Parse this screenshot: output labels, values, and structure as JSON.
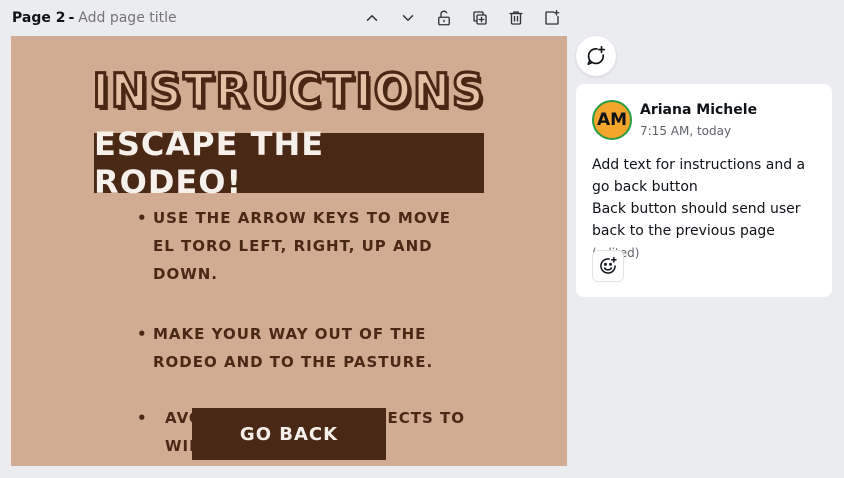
{
  "page_header": {
    "page_label": "Page 2",
    "dash": "-",
    "title_placeholder": "Add page title"
  },
  "toolbar_icons": [
    "chevron-up-icon",
    "chevron-down-icon",
    "unlock-icon",
    "duplicate-icon",
    "trash-icon",
    "add-page-icon"
  ],
  "canvas": {
    "heading": "INSTRUCTIONS",
    "banner": "ESCAPE THE RODEO!",
    "items": [
      "USE THE ARROW KEYS TO MOVE EL TORO LEFT, RIGHT, UP AND DOWN.",
      "MAKE YOUR WAY OUT OF THE RODEO AND TO THE PASTURE.",
      "AVOID ALL PASSING OBJECTS TO WIN!"
    ],
    "back_button": "GO BACK",
    "colors": {
      "background": "#d2ac92",
      "dark_brown": "#4a2816",
      "light_text": "#f6f0ea"
    }
  },
  "comment": {
    "avatar_initials": "AM",
    "author": "Ariana Michele",
    "time": "7:15 AM, today",
    "line1": "Add text for instructions and a go back button",
    "line2": "Back button should send user back to the previous page",
    "edited": "(edited)"
  }
}
